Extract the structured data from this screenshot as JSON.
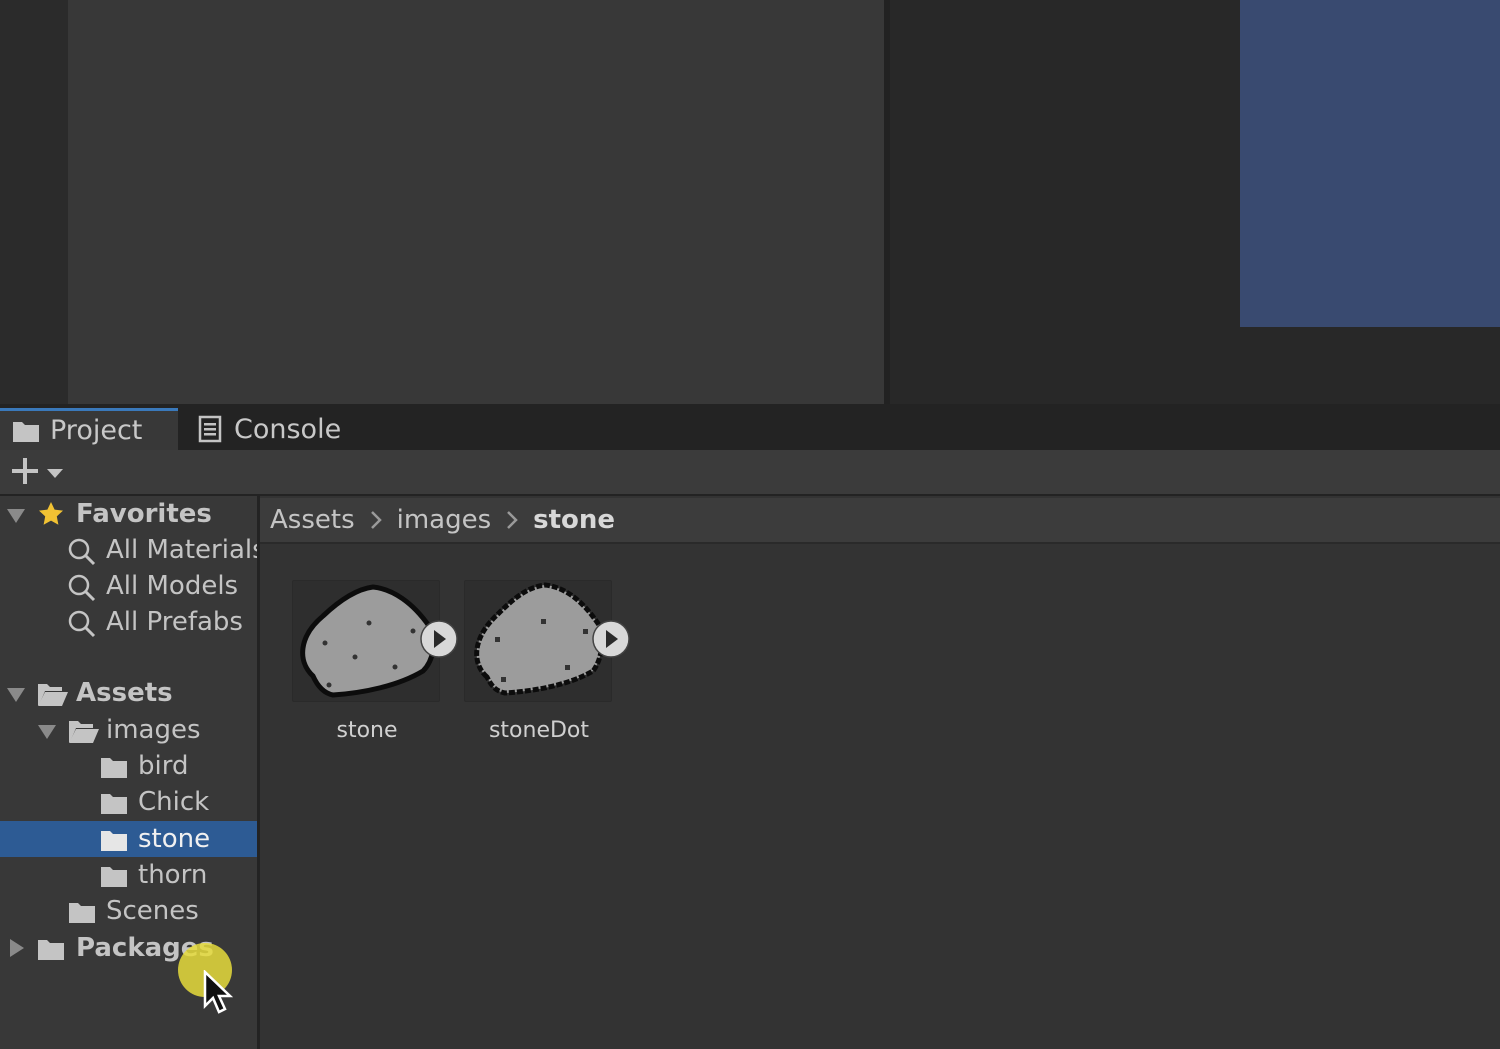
{
  "tabs": [
    {
      "label": "Project",
      "icon": "folder-icon",
      "active": true
    },
    {
      "label": "Console",
      "icon": "console-icon",
      "active": false
    }
  ],
  "toolbar": {
    "add_icon": "plus-icon",
    "dropdown_icon": "caret-down-icon"
  },
  "tree": {
    "favorites": {
      "label": "Favorites",
      "items": [
        {
          "label": "All Materials"
        },
        {
          "label": "All Models"
        },
        {
          "label": "All Prefabs"
        }
      ]
    },
    "assets": {
      "label": "Assets",
      "images": {
        "label": "images",
        "children": [
          {
            "label": "bird"
          },
          {
            "label": "Chick"
          },
          {
            "label": "stone",
            "selected": true
          },
          {
            "label": "thorn"
          }
        ]
      },
      "scenes": {
        "label": "Scenes"
      }
    },
    "packages": {
      "label": "Packages"
    }
  },
  "breadcrumb": {
    "items": [
      "Assets",
      "images"
    ],
    "current": "stone"
  },
  "assets_grid": [
    {
      "label": "stone",
      "icon": "stone-sprite-icon"
    },
    {
      "label": "stoneDot",
      "icon": "stone-dot-sprite-icon"
    }
  ],
  "colors": {
    "accent": "#3a79bb",
    "selection": "#2d5b94",
    "scene_blue": "#394a70",
    "cursor_highlight": "#e6dc3c"
  }
}
